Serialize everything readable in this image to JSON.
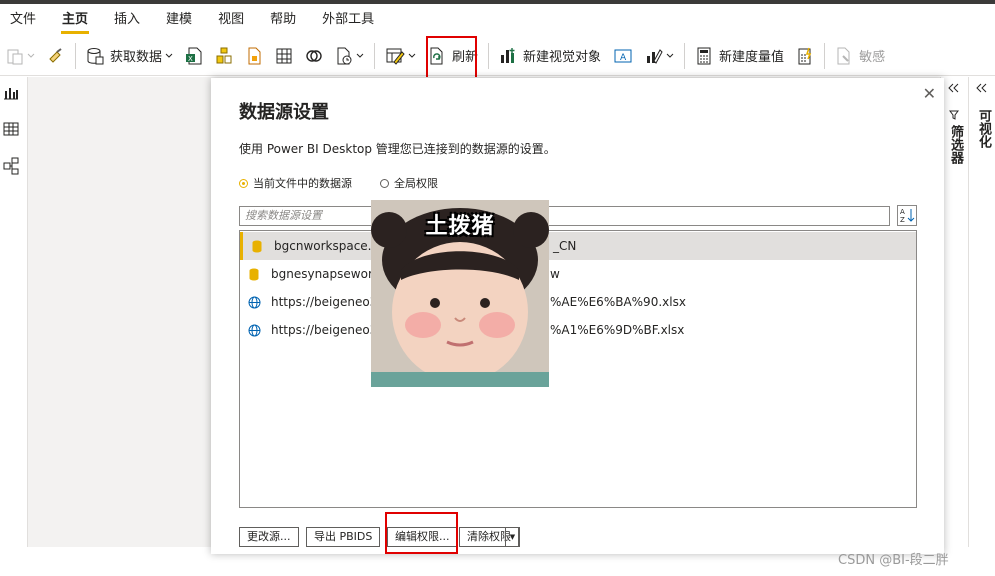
{
  "menu": {
    "items": [
      "文件",
      "主页",
      "插入",
      "建模",
      "视图",
      "帮助",
      "外部工具"
    ],
    "active": "主页"
  },
  "ribbon": {
    "get_data": "获取数据",
    "refresh": "刷新",
    "new_visual": "新建视觉对象",
    "new_measure": "新建度量值",
    "sensitivity": "敏感"
  },
  "right_panes": {
    "visualizations": "可视化",
    "filters": "筛选器"
  },
  "dialog": {
    "title": "数据源设置",
    "description": "使用 Power BI Desktop 管理您已连接到的数据源的设置。",
    "radio_current": "当前文件中的数据源",
    "radio_global": "全局权限",
    "search_placeholder": "搜索数据源设置",
    "rows": [
      {
        "text": "bgcnworkspace.sql",
        "tail": "_CN",
        "icon": "database-icon"
      },
      {
        "text": "bgnesynapseworks",
        "tail": "w",
        "icon": "database-icon"
      },
      {
        "text": "https://beigeneo36",
        "tail": "%AE%E6%BA%90.xlsx",
        "icon": "globe-icon"
      },
      {
        "text": "https://beigeneo36",
        "tail": "%A1%E6%9D%BF.xlsx",
        "icon": "globe-icon"
      }
    ],
    "buttons": {
      "change_source": "更改源...",
      "export_pbids": "导出 PBIDS",
      "edit_permissions": "编辑权限...",
      "clear_permissions": "清除权限"
    }
  },
  "overlay": {
    "caption": "土拨猪"
  },
  "watermark": "CSDN @BI-段二胖",
  "colors": {
    "accent": "#e8b100",
    "highlight_red": "#e00000"
  }
}
